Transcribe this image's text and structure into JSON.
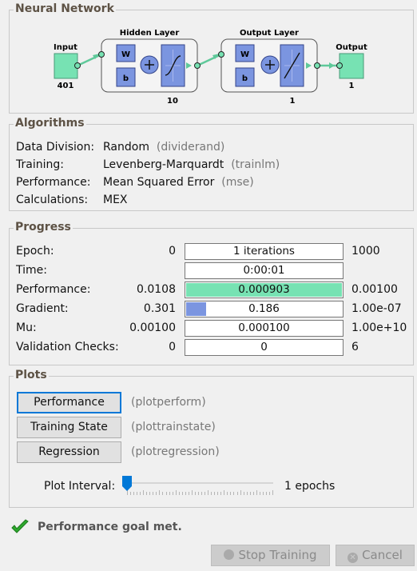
{
  "network": {
    "title": "Neural Network",
    "input_label": "Input",
    "input_size": "401",
    "hidden_title": "Hidden Layer",
    "hidden_size": "10",
    "output_layer_title": "Output Layer",
    "output_layer_size": "1",
    "output_label": "Output",
    "output_size": "1",
    "weight_label": "W",
    "bias_label": "b",
    "colors": {
      "io": "#77e2b3",
      "block": "#7b95e0",
      "wire": "#77e2b3"
    }
  },
  "algorithms": {
    "title": "Algorithms",
    "rows": [
      {
        "label": "Data Division:",
        "value": "Random",
        "fn": "(dividerand)"
      },
      {
        "label": "Training:",
        "value": "Levenberg-Marquardt",
        "fn": "(trainlm)"
      },
      {
        "label": "Performance:",
        "value": "Mean Squared Error",
        "fn": "(mse)"
      },
      {
        "label": "Calculations:",
        "value": "MEX",
        "fn": ""
      }
    ]
  },
  "progress": {
    "title": "Progress",
    "rows": [
      {
        "label": "Epoch:",
        "start": "0",
        "current": "1 iterations",
        "end": "1000",
        "fill": 0.0,
        "color": ""
      },
      {
        "label": "Time:",
        "start": "",
        "current": "0:00:01",
        "end": "",
        "fill": 0.0,
        "color": ""
      },
      {
        "label": "Performance:",
        "start": "0.0108",
        "current": "0.000903",
        "end": "0.00100",
        "fill": 1.0,
        "color": "#77e2b3"
      },
      {
        "label": "Gradient:",
        "start": "0.301",
        "current": "0.186",
        "end": "1.00e-07",
        "fill": 0.13,
        "color": "#7b95e0"
      },
      {
        "label": "Mu:",
        "start": "0.00100",
        "current": "0.000100",
        "end": "1.00e+10",
        "fill": 0.0,
        "color": ""
      },
      {
        "label": "Validation Checks:",
        "start": "0",
        "current": "0",
        "end": "6",
        "fill": 0.0,
        "color": ""
      }
    ]
  },
  "plots": {
    "title": "Plots",
    "buttons": [
      {
        "label": "Performance",
        "fn": "(plotperform)"
      },
      {
        "label": "Training State",
        "fn": "(plottrainstate)"
      },
      {
        "label": "Regression",
        "fn": "(plotregression)"
      }
    ],
    "interval_label": "Plot Interval:",
    "interval_value": "1 epochs",
    "slider_fraction": 0.0
  },
  "status": {
    "icon": "check-icon",
    "text": "Performance goal met.",
    "color": "#2ea82e"
  },
  "footer": {
    "stop_label": "Stop Training",
    "cancel_label": "Cancel"
  }
}
